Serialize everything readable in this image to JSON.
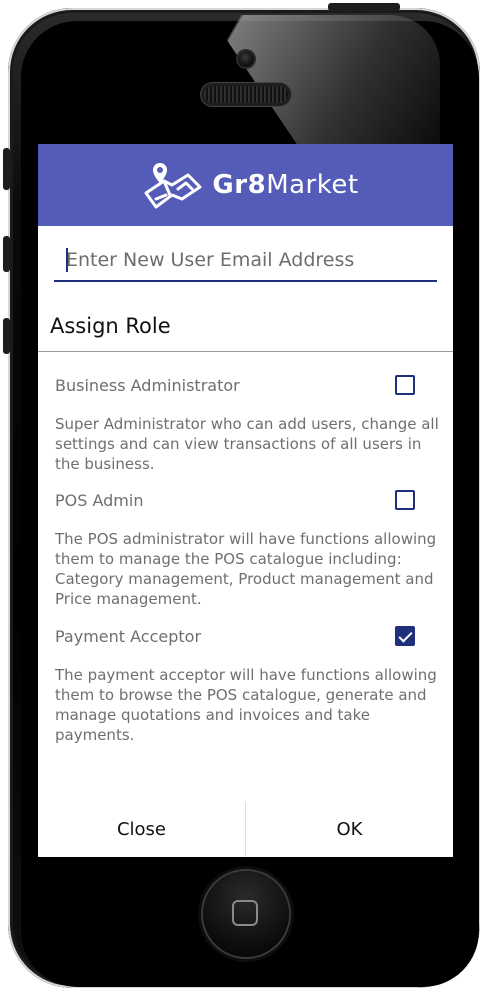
{
  "app": {
    "brand_bold": "Gr8",
    "brand_light": "Market",
    "brand_color": "#545cb8"
  },
  "email": {
    "placeholder": "Enter New User Email Address",
    "value": ""
  },
  "assign_role": {
    "title": "Assign Role"
  },
  "roles": [
    {
      "name": "Business Administrator",
      "description": "Super Administrator who can add users, change all settings and can view transactions of all users in the business.",
      "checked": false
    },
    {
      "name": "POS Admin",
      "description": "The POS administrator will have functions allowing them to manage the POS catalogue including: Category management, Product management and Price management.",
      "checked": false
    },
    {
      "name": "Payment Acceptor",
      "description": "The payment acceptor will have functions allowing them to browse the POS catalogue, generate and manage quotations and invoices and take payments.",
      "checked": true
    }
  ],
  "actions": {
    "close_label": "Close",
    "ok_label": "OK"
  },
  "colors": {
    "accent": "#1f2f7a",
    "header": "#545cb8"
  }
}
